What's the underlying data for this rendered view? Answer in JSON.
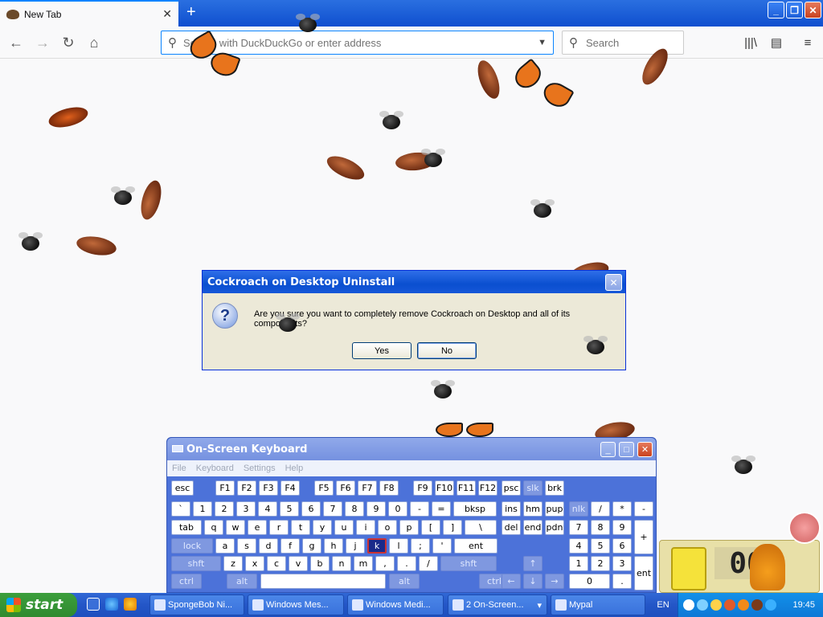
{
  "browser": {
    "tab_title": "New Tab",
    "new_tab_symbol": "+",
    "url_placeholder": "Search with DuckDuckGo or enter address",
    "search_placeholder": "Search",
    "window_controls": [
      "minimize-icon",
      "restore-icon",
      "close-icon"
    ]
  },
  "dialog": {
    "title": "Cockroach on Desktop Uninstall",
    "question_mark": "?",
    "message": "Are you sure you want to completely remove Cockroach on Desktop and all of its components?",
    "yes": "Yes",
    "no": "No"
  },
  "osk": {
    "title": "On-Screen Keyboard",
    "menu": [
      "File",
      "Keyboard",
      "Settings",
      "Help"
    ],
    "keys": [
      [
        "esc",
        "F1",
        "F2",
        "F3",
        "F4",
        "F5",
        "F6",
        "F7",
        "F8",
        "F9",
        "F10",
        "F11",
        "F12",
        "psc",
        "slk",
        "brk"
      ],
      [
        "`",
        "1",
        "2",
        "3",
        "4",
        "5",
        "6",
        "7",
        "8",
        "9",
        "0",
        "-",
        "=",
        "bksp",
        "ins",
        "hm",
        "pup",
        "nlk",
        "/",
        "*",
        "-"
      ],
      [
        "tab",
        "q",
        "w",
        "e",
        "r",
        "t",
        "y",
        "u",
        "i",
        "o",
        "p",
        "[",
        "]",
        "\\",
        "del",
        "end",
        "pdn",
        "7",
        "8",
        "9",
        "+"
      ],
      [
        "lock",
        "a",
        "s",
        "d",
        "f",
        "g",
        "h",
        "j",
        "k",
        "l",
        ";",
        "'",
        "ent",
        "4",
        "5",
        "6"
      ],
      [
        "shft",
        "z",
        "x",
        "c",
        "v",
        "b",
        "n",
        "m",
        ",",
        ".",
        "/",
        "shft",
        "↑",
        "1",
        "2",
        "3",
        "ent"
      ],
      [
        "ctrl",
        "alt",
        "",
        "alt",
        "ctrl",
        "←",
        "↓",
        "→",
        "0",
        "."
      ]
    ],
    "selected_key": "k"
  },
  "widget": {
    "digits": "00"
  },
  "taskbar": {
    "start": "start",
    "tasks": [
      "SpongeBob Ni...",
      "Windows Mes...",
      "Windows Medi...",
      "2 On-Screen...",
      "Mypal"
    ],
    "lang": "EN",
    "clock": "19:45"
  }
}
